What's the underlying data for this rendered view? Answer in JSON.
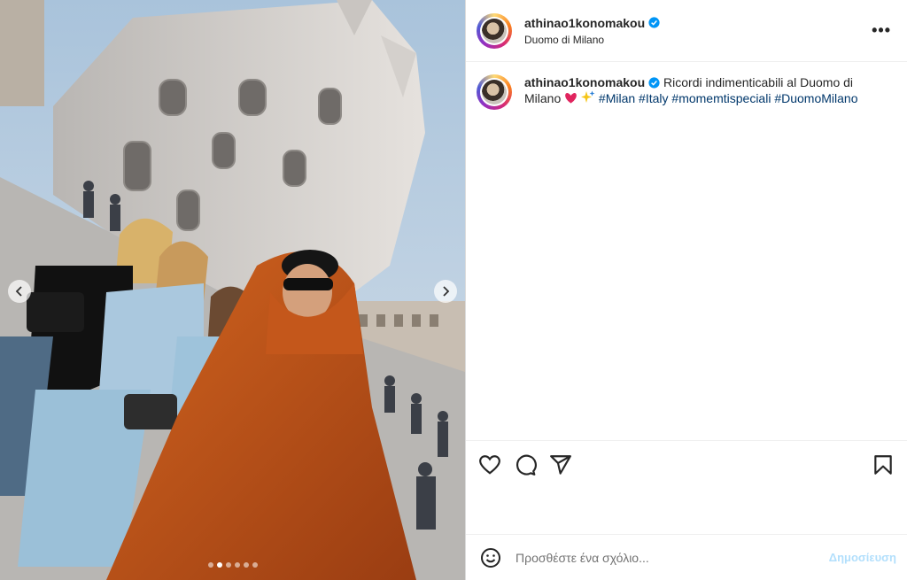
{
  "post": {
    "username": "athinao1konomakou",
    "location": "Duomo di Milano",
    "caption_text": "Ricordi indimenticabili al Duomo di Milano",
    "caption_hashtags": "#Milan #Italy #momemtispeciali #DuomoMilano",
    "more_label": "•••"
  },
  "carousel": {
    "total_slides": 6,
    "active_slide": 2
  },
  "comment": {
    "placeholder": "Προσθέστε ένα σχόλιο...",
    "post_label": "Δημοσίευση"
  },
  "colors": {
    "verified": "#0095f6",
    "hashtag": "#00376b",
    "post_disabled": "#b2dffc"
  },
  "icons": {
    "like": "heart-icon",
    "comment": "comment-icon",
    "share": "share-icon",
    "save": "bookmark-icon",
    "emoji": "emoji-icon"
  }
}
